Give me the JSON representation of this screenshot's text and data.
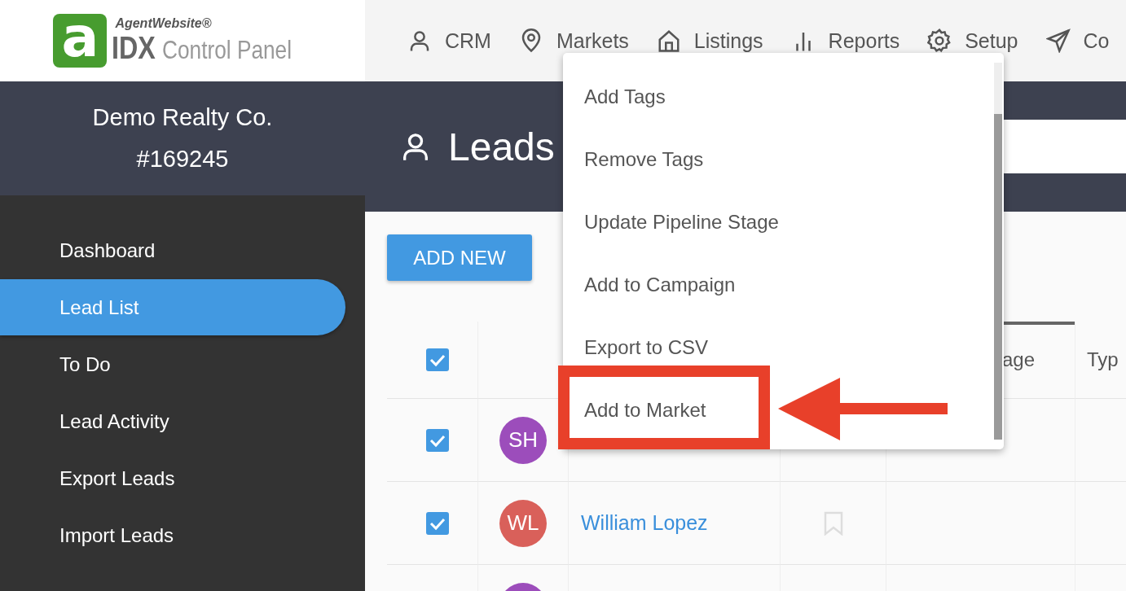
{
  "logo": {
    "mark": "a",
    "brand": "AgentWebsite®",
    "product_bold": "IDX",
    "product": "Control Panel"
  },
  "account": {
    "name": "Demo Realty Co.",
    "number": "#169245"
  },
  "sidebar": {
    "items": [
      {
        "label": "Dashboard",
        "selected": false
      },
      {
        "label": "Lead List",
        "selected": true
      },
      {
        "label": "To Do",
        "selected": false
      },
      {
        "label": "Lead Activity",
        "selected": false
      },
      {
        "label": "Export Leads",
        "selected": false
      },
      {
        "label": "Import Leads",
        "selected": false
      }
    ]
  },
  "top_nav": [
    {
      "label": "CRM"
    },
    {
      "label": "Markets"
    },
    {
      "label": "Listings"
    },
    {
      "label": "Reports"
    },
    {
      "label": "Setup"
    },
    {
      "label": "Co"
    }
  ],
  "page": {
    "title": "Leads"
  },
  "add_button": "ADD NEW",
  "table": {
    "select_all": {
      "checked": true
    },
    "columns": [
      {
        "label": "age"
      },
      {
        "label": "Typ"
      }
    ],
    "rows": [
      {
        "checked": true,
        "initials": "SH",
        "color": "#9c4dbb"
      },
      {
        "checked": true,
        "initials": "WL",
        "color": "#d9605a",
        "name": "William Lopez"
      },
      {
        "color": "#9c4dbb"
      }
    ]
  },
  "menu": {
    "items": [
      {
        "label": "Add Tags",
        "annotated": false
      },
      {
        "label": "Remove Tags",
        "annotated": false
      },
      {
        "label": "Update Pipeline Stage",
        "annotated": false
      },
      {
        "label": "Add to Campaign",
        "annotated": false
      },
      {
        "label": "Export to CSV",
        "annotated": false
      },
      {
        "label": "Add to Market",
        "annotated": true
      }
    ]
  }
}
